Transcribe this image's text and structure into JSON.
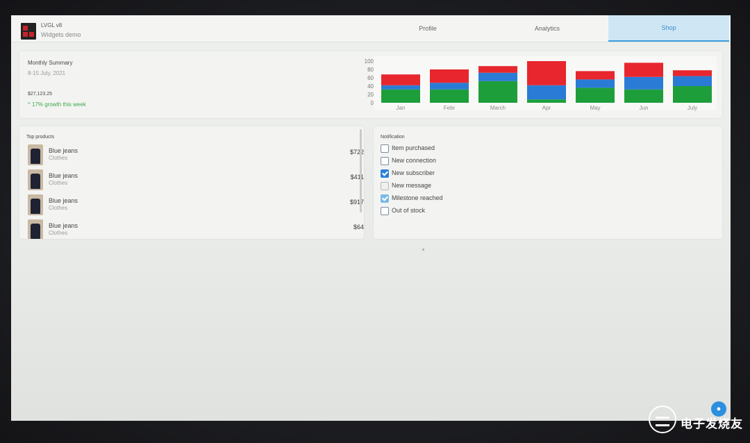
{
  "header": {
    "app_name": "LVGL v8",
    "subtitle": "Widgets demo",
    "tabs": [
      {
        "label": "Profile",
        "active": false
      },
      {
        "label": "Analytics",
        "active": false
      },
      {
        "label": "Shop",
        "active": true
      }
    ],
    "active_tab_mark": "✓"
  },
  "summary": {
    "title": "Monthly Summary",
    "date_range": "8-15 July, 2021",
    "total": "$27,123.25",
    "growth": "17% growth this week",
    "growth_arrow": "^"
  },
  "chart_data": {
    "type": "bar",
    "stacked": true,
    "categories": [
      "Jan",
      "Febr",
      "March",
      "Apr",
      "May",
      "Jun",
      "July"
    ],
    "ylim": [
      0,
      100
    ],
    "yticks": [
      100,
      80,
      60,
      40,
      20,
      0
    ],
    "series": [
      {
        "color": "#1e9e3a",
        "values": [
          32,
          32,
          52,
          8,
          36,
          32,
          40
        ]
      },
      {
        "color": "#2a7bd6",
        "values": [
          10,
          16,
          20,
          34,
          20,
          30,
          24
        ]
      },
      {
        "color": "#e8262d",
        "values": [
          26,
          32,
          16,
          58,
          20,
          34,
          14
        ]
      }
    ],
    "xlabel": "",
    "ylabel": "",
    "grid": false
  },
  "products": {
    "title": "Top products",
    "items": [
      {
        "name": "Blue jeans",
        "category": "Clothes",
        "price": "$722"
      },
      {
        "name": "Blue jeans",
        "category": "Clothes",
        "price": "$411"
      },
      {
        "name": "Blue jeans",
        "category": "Clothes",
        "price": "$917"
      },
      {
        "name": "Blue jeans",
        "category": "Clothes",
        "price": "$64"
      }
    ]
  },
  "notifications": {
    "title": "Notification",
    "items": [
      {
        "label": "Item purchased",
        "checked": false,
        "disabled": false
      },
      {
        "label": "New connection",
        "checked": false,
        "disabled": false
      },
      {
        "label": "New subscriber",
        "checked": true,
        "disabled": false
      },
      {
        "label": "New message",
        "checked": false,
        "disabled": true
      },
      {
        "label": "Milestone reached",
        "checked": true,
        "disabled": true
      },
      {
        "label": "Out of stock",
        "checked": false,
        "disabled": false
      }
    ]
  },
  "fab": {
    "icon": "water-drop-icon",
    "glyph": "●"
  },
  "watermark": {
    "text": "电子发烧友"
  }
}
